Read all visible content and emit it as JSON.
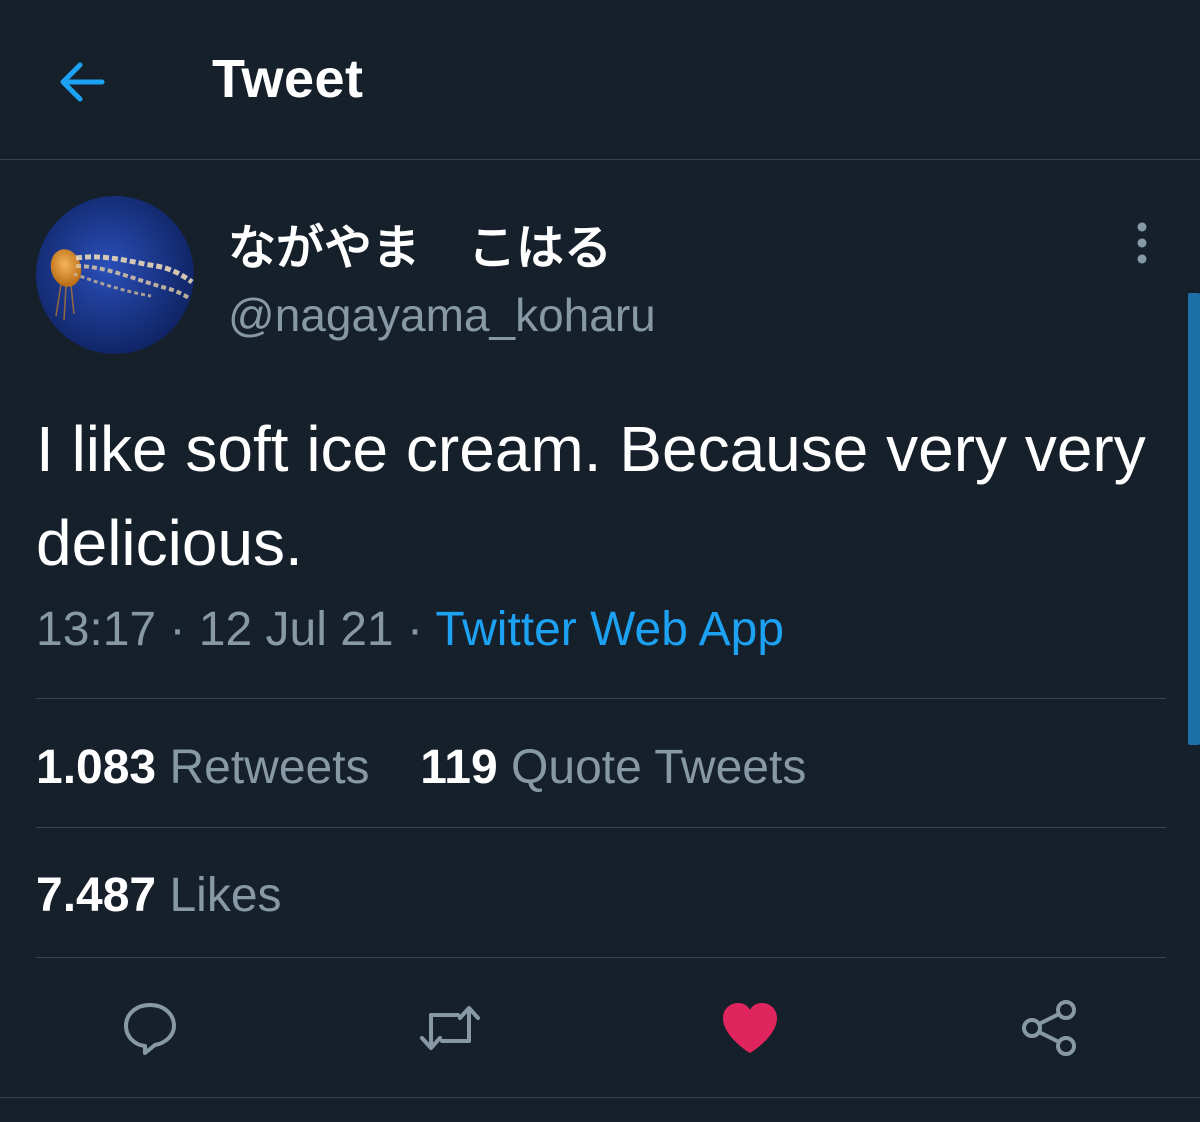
{
  "header": {
    "title": "Tweet"
  },
  "author": {
    "display_name": "ながやま　こはる",
    "handle": "@nagayama_koharu"
  },
  "tweet": {
    "text": "I like soft ice cream. Because very very delicious.",
    "time": "13:17",
    "date": "12 Jul 21",
    "separator": "·",
    "source": "Twitter Web App"
  },
  "stats": {
    "retweets_count": "1.083",
    "retweets_label": "Retweets",
    "quotes_count": "119",
    "quotes_label": "Quote Tweets",
    "likes_count": "7.487",
    "likes_label": "Likes"
  },
  "colors": {
    "background": "#15202b",
    "accent": "#1da1f2",
    "like": "#e0245e",
    "muted": "#8899a6"
  },
  "icons": [
    "back-arrow-icon",
    "more-vertical-icon",
    "reply-icon",
    "retweet-icon",
    "heart-filled-icon",
    "share-icon"
  ]
}
